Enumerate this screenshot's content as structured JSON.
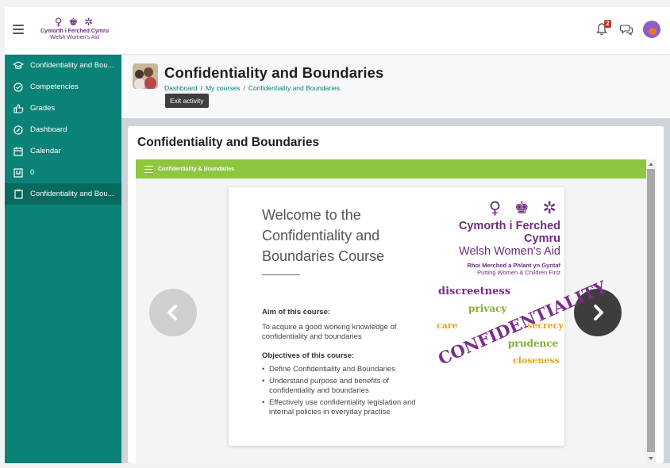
{
  "app": {
    "brand_cy": "Cymorth i Ferched Cymru",
    "brand_en": "Welsh Women's Aid",
    "notification_count": "2"
  },
  "sidebar": {
    "items": [
      {
        "label": "Confidentiality and Bou...",
        "icon": "graduation-cap-icon",
        "active": false
      },
      {
        "label": "Competencies",
        "icon": "check-circle-icon",
        "active": false
      },
      {
        "label": "Grades",
        "icon": "thumbs-up-icon",
        "active": false
      },
      {
        "label": "Dashboard",
        "icon": "gauge-icon",
        "active": false
      },
      {
        "label": "Calendar",
        "icon": "calendar-icon",
        "active": false
      },
      {
        "label": "0",
        "icon": "box-icon",
        "active": false
      },
      {
        "label": "Confidentiality and Bou...",
        "icon": "clipboard-icon",
        "active": true
      }
    ]
  },
  "header": {
    "title": "Confidentiality and Boundaries",
    "breadcrumb": [
      "Dashboard",
      "My courses",
      "Confidentiality and Boundaries"
    ],
    "breadcrumb_sep": "/",
    "exit_label": "Exit activity"
  },
  "main": {
    "section_title": "Confidentiality and Boundaries",
    "player_title": "Confidentiality & Boundaries",
    "slide": {
      "welcome": "Welcome to the Confidentiality and Boundaries Course",
      "aim_heading": "Aim of this course:",
      "aim_text": "To acquire a good working knowledge of confidentiality and boundaries",
      "objectives_heading": "Objectives of this course:",
      "objectives": [
        "Define Confidentiality and Boundaries",
        "Understand purpose and benefits of confidentiality and boundaries",
        "Effectively use confidentiality legislation and internal policies in everyday practise"
      ],
      "logo": {
        "cy": "Cymorth i Ferched Cymru",
        "en": "Welsh Women's Aid",
        "sub_cy": "Rhoi Merched a Phlant yn Gyntaf",
        "sub_en": "Putting Women & Children First"
      },
      "wordcloud": {
        "discreetness": "discreetness",
        "privacy": "privacy",
        "care": "care",
        "secrecy": "secrecy",
        "prudence": "prudence",
        "confidentiality": "CONFIDENTIALITY",
        "closeness": "closeness"
      }
    }
  },
  "colors": {
    "sidebar": "#0b8277",
    "player_bar": "#8dc63f",
    "brand_purple": "#6b2e7e"
  }
}
